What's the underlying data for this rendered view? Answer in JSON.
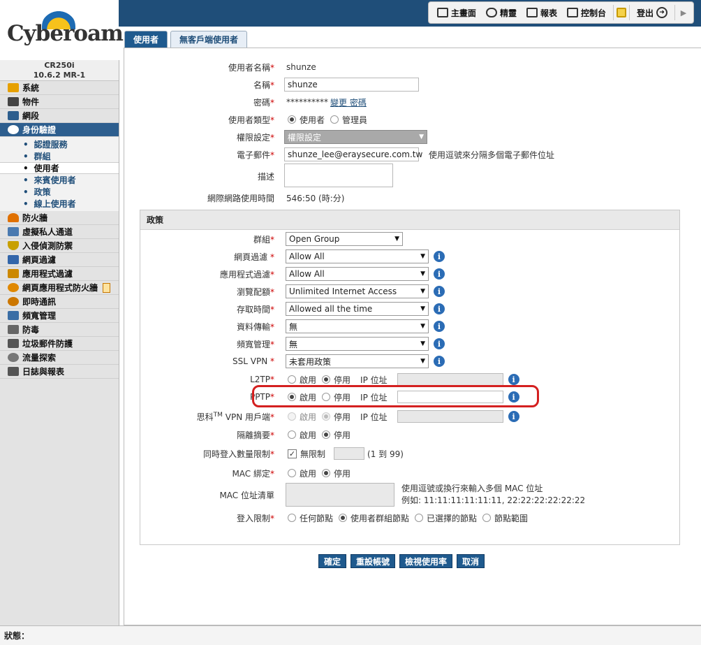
{
  "header": {
    "menu": [
      {
        "label": "主畫面",
        "icon": "home-icon"
      },
      {
        "label": "精靈",
        "icon": "wizard-icon"
      },
      {
        "label": "報表",
        "icon": "report-icon"
      },
      {
        "label": "控制台",
        "icon": "console-icon"
      },
      {
        "label": "登出",
        "icon": "logout-icon"
      }
    ]
  },
  "brand": {
    "logo_text": "Cyberoam",
    "model": "CR250i",
    "version": "10.6.2 MR-1"
  },
  "sidebar": {
    "items": [
      {
        "label": "系統",
        "color": "#e6a000"
      },
      {
        "label": "物件",
        "color": "#444444"
      },
      {
        "label": "網段",
        "color": "#2d5e8e"
      },
      {
        "label": "身份驗證",
        "color": "#ffffff"
      },
      {
        "label": "防火牆",
        "color": "#e07000"
      },
      {
        "label": "虛擬私人通道",
        "color": "#4a7ab0"
      },
      {
        "label": "入侵偵測防禦",
        "color": "#c8a000"
      },
      {
        "label": "網頁過濾",
        "color": "#3366aa"
      },
      {
        "label": "應用程式過濾",
        "color": "#cc8800"
      },
      {
        "label": "網頁應用程式防火牆",
        "color": "#e08800"
      },
      {
        "label": "即時通訊",
        "color": "#cc7700"
      },
      {
        "label": "頻寬管理",
        "color": "#3b6ea5"
      },
      {
        "label": "防毒",
        "color": "#666666"
      },
      {
        "label": "垃圾郵件防護",
        "color": "#555555"
      },
      {
        "label": "流量探索",
        "color": "#777777"
      },
      {
        "label": "日誌與報表",
        "color": "#555555"
      }
    ],
    "sub_items": [
      "認證服務",
      "群組",
      "使用者",
      "來賓使用者",
      "政策",
      "線上使用者"
    ]
  },
  "tabs": [
    "使用者",
    "無客戶端使用者"
  ],
  "form": {
    "username": {
      "label": "使用者名稱",
      "value": "shunze"
    },
    "name": {
      "label": "名稱",
      "value": "shunze"
    },
    "password": {
      "label": "密碼",
      "value": "**********",
      "link": "變更 密碼"
    },
    "user_type": {
      "label": "使用者類型",
      "opt1": "使用者",
      "opt2": "管理員"
    },
    "profile": {
      "label": "權限設定",
      "value": "權限設定"
    },
    "email": {
      "label": "電子郵件",
      "value": "shunze_lee@eraysecure.com.tw",
      "hint": "使用逗號來分隔多個電子郵件位址"
    },
    "description": {
      "label": "描述"
    },
    "usage": {
      "label": "網際網路使用時間",
      "value": "546:50 (時:分)"
    }
  },
  "policy": {
    "title": "政策",
    "group": {
      "label": "群組",
      "value": "Open Group"
    },
    "web_filter": {
      "label": "網頁過濾",
      "value": "Allow All"
    },
    "app_filter": {
      "label": "應用程式過濾",
      "value": "Allow All"
    },
    "surfing_quota": {
      "label": "瀏覽配額",
      "value": "Unlimited Internet Access"
    },
    "access_time": {
      "label": "存取時間",
      "value": "Allowed all the time"
    },
    "data_transfer": {
      "label": "資料傳輸",
      "value": "無"
    },
    "qos": {
      "label": "頻寬管理",
      "value": "無"
    },
    "ssl_vpn": {
      "label": "SSL VPN",
      "value": "未套用政策"
    },
    "l2tp": {
      "label": "L2TP"
    },
    "pptp": {
      "label": "PPTP"
    },
    "cisco_vpn": {
      "label_pre": "思科",
      "label_sup": "TM",
      "label_post": " VPN 用戶端"
    },
    "quarantine": {
      "label": "隔離摘要"
    },
    "login_limit": {
      "label": "同時登入數量限制",
      "checkbox_label": "無限制",
      "range": "(1 到 99)"
    },
    "mac_binding": {
      "label": "MAC 綁定"
    },
    "mac_list": {
      "label": "MAC 位址清單",
      "hint1": "使用逗號或換行來輸入多個 MAC 位址",
      "hint2": "例如: 11:11:11:11:11:11, 22:22:22:22:22:22"
    },
    "node_restriction": {
      "label": "登入限制",
      "opt1": "任何節點",
      "opt2": "使用者群組節點",
      "opt3": "已選擇的節點",
      "opt4": "節點範圍"
    },
    "enable": "啟用",
    "disable": "停用",
    "ip_label": "IP 位址"
  },
  "buttons": {
    "ok": "確定",
    "reset": "重設帳號",
    "usage": "檢視使用率",
    "cancel": "取消"
  },
  "status": {
    "label": "狀態："
  }
}
